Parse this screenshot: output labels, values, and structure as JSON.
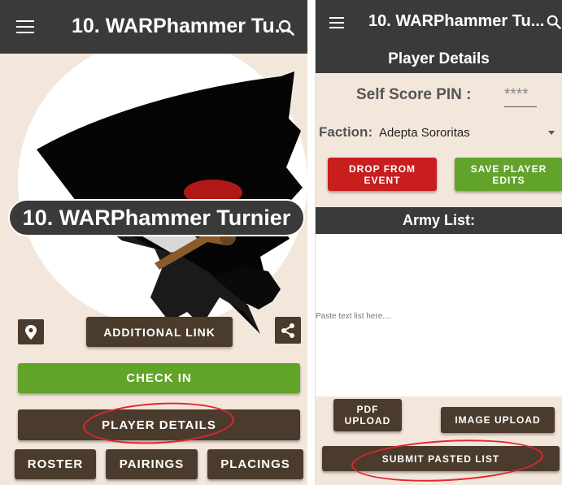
{
  "left": {
    "appbar": {
      "title": "10. WARPhammer Tu..."
    },
    "banner_title": "10. WARPhammer Turnier",
    "buttons": {
      "additional_link": "ADDITIONAL LINK",
      "check_in": "CHECK IN",
      "player_details": "PLAYER DETAILS",
      "roster": "ROSTER",
      "pairings": "PAIRINGS",
      "placings": "PLACINGS"
    }
  },
  "right": {
    "appbar": {
      "title": "10. WARPhammer Tu..."
    },
    "header": "Player Details",
    "pin": {
      "label": "Self Score PIN :",
      "value": "****"
    },
    "faction": {
      "label": "Faction:",
      "value": "Adepta Sororitas"
    },
    "buttons": {
      "drop": "DROP FROM EVENT",
      "save": "SAVE PLAYER EDITS",
      "pdf_upload": "PDF UPLOAD",
      "image_upload": "IMAGE UPLOAD",
      "submit_list": "SUBMIT PASTED LIST"
    },
    "army_list": {
      "header": "Army List:",
      "placeholder": "Paste text list here...."
    }
  },
  "colors": {
    "appbar": "#3a3a3a",
    "dark_button": "#4a3b2c",
    "green_button": "#62a32a",
    "red_button": "#c81e1e",
    "beige_bg": "#f3e7dc",
    "annotation": "#e3262a"
  }
}
